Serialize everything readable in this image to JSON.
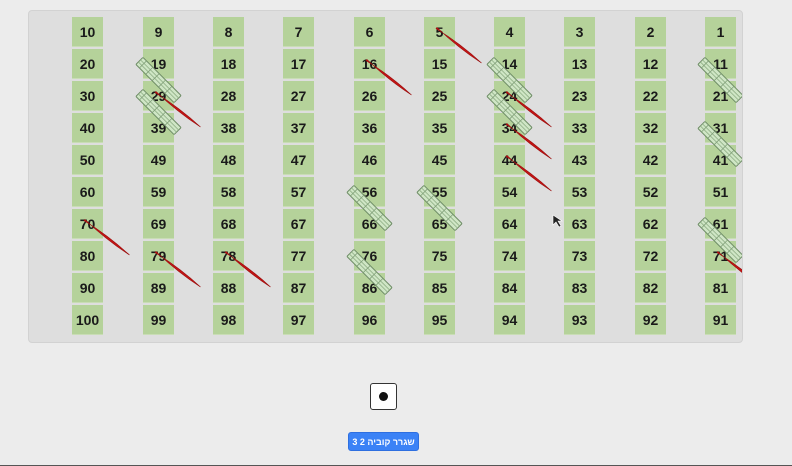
{
  "board": {
    "rows": [
      [
        10,
        9,
        8,
        7,
        6,
        5,
        4,
        3,
        2,
        1
      ],
      [
        20,
        19,
        18,
        17,
        16,
        15,
        14,
        13,
        12,
        11
      ],
      [
        30,
        29,
        28,
        27,
        26,
        25,
        24,
        23,
        22,
        21
      ],
      [
        40,
        39,
        38,
        37,
        36,
        35,
        34,
        33,
        32,
        31
      ],
      [
        50,
        49,
        48,
        47,
        46,
        45,
        44,
        43,
        42,
        41
      ],
      [
        60,
        59,
        58,
        57,
        56,
        55,
        54,
        53,
        52,
        51
      ],
      [
        70,
        69,
        68,
        67,
        66,
        65,
        64,
        63,
        62,
        61
      ],
      [
        80,
        79,
        78,
        77,
        76,
        75,
        74,
        73,
        72,
        71
      ],
      [
        90,
        89,
        88,
        87,
        86,
        85,
        84,
        83,
        82,
        81
      ],
      [
        100,
        99,
        98,
        97,
        96,
        95,
        94,
        93,
        92,
        91
      ]
    ],
    "cell_color": "#b5d29a",
    "snake_color": "#c41414",
    "ladder_color": "#cfe6c5",
    "snakes": [
      {
        "from": 5,
        "to": 15
      },
      {
        "from": 16,
        "to": 26
      },
      {
        "from": 29,
        "to": 39
      },
      {
        "from": 24,
        "to": 34
      },
      {
        "from": 34,
        "to": 44
      },
      {
        "from": 44,
        "to": 54
      },
      {
        "from": 70,
        "to": 80
      },
      {
        "from": 79,
        "to": 89
      },
      {
        "from": 78,
        "to": 88
      },
      {
        "from": 71,
        "to": 81
      }
    ],
    "ladders": [
      {
        "from": 29,
        "to": 19
      },
      {
        "from": 39,
        "to": 29
      },
      {
        "from": 66,
        "to": 56
      },
      {
        "from": 86,
        "to": 76
      },
      {
        "from": 65,
        "to": 55
      },
      {
        "from": 24,
        "to": 14
      },
      {
        "from": 34,
        "to": 24
      },
      {
        "from": 21,
        "to": 11
      },
      {
        "from": 41,
        "to": 31
      },
      {
        "from": 71,
        "to": 61
      }
    ]
  },
  "dice": {
    "value": 1
  },
  "controls": {
    "roll_label": "3 2 שגרר קוביה"
  }
}
